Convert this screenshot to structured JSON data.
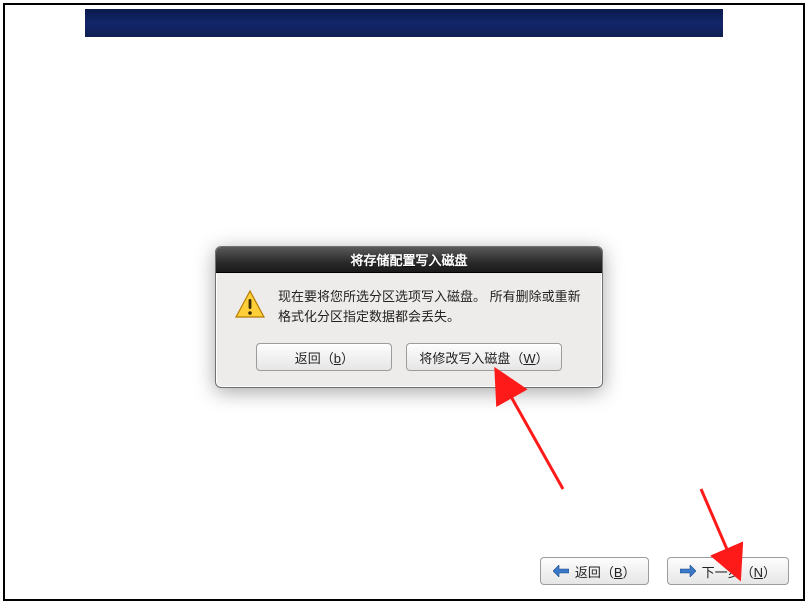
{
  "dialog": {
    "title": "将存储配置写入磁盘",
    "message": "现在要将您所选分区选项写入磁盘。 所有删除或重新格式化分区指定数据都会丢失。",
    "buttons": {
      "back_prefix": "返回（",
      "back_mnem": "b",
      "back_suffix": "）",
      "write_prefix": "将修改写入磁盘（",
      "write_mnem": "W",
      "write_suffix": "）"
    }
  },
  "nav": {
    "back_prefix": "返回（",
    "back_mnem": "B",
    "back_suffix": "）",
    "next_prefix": "下一步（",
    "next_mnem": "N",
    "next_suffix": "）"
  },
  "colors": {
    "banner": "#12266a",
    "arrowRed": "#ff1a1a"
  }
}
